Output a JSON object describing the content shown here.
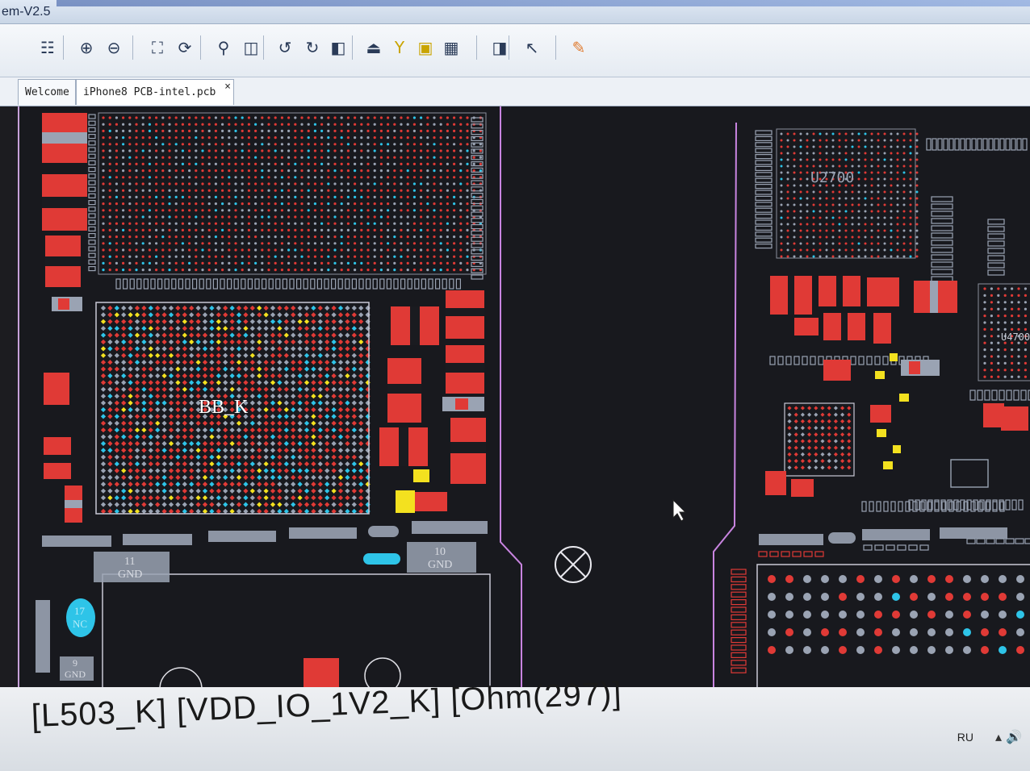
{
  "window": {
    "title": "em-V2.5"
  },
  "toolbar": {
    "icons": [
      {
        "name": "layers-tree-icon",
        "glyph": "☷"
      },
      {
        "name": "zoom-in-icon",
        "glyph": "⊕"
      },
      {
        "name": "zoom-out-icon",
        "glyph": "⊖"
      },
      {
        "name": "fit-view-icon",
        "glyph": "⛶"
      },
      {
        "name": "refresh-icon",
        "glyph": "⟳"
      },
      {
        "name": "search-icon",
        "glyph": "⚲"
      },
      {
        "name": "compare-icon",
        "glyph": "◫"
      },
      {
        "name": "rotate-left-icon",
        "glyph": "↺"
      },
      {
        "name": "rotate-right-icon",
        "glyph": "↻"
      },
      {
        "name": "mirror-icon",
        "glyph": "◧"
      },
      {
        "name": "probe-icon",
        "glyph": "⏏"
      },
      {
        "name": "pin-icon",
        "glyph": "Y"
      },
      {
        "name": "component-icon",
        "glyph": "▣"
      },
      {
        "name": "value-icon",
        "glyph": "▦"
      },
      {
        "name": "panel-icon",
        "glyph": "◨"
      },
      {
        "name": "pointer-icon",
        "glyph": "↖"
      },
      {
        "name": "notes-icon",
        "glyph": "✎"
      }
    ]
  },
  "tabs": [
    {
      "label": "Welcome"
    },
    {
      "label": "iPhone8 PCB-intel.pcb"
    }
  ],
  "pcb": {
    "labels": {
      "chip_left": "BB_K",
      "chip_top_right": "U2700",
      "chip_right": "U4700",
      "pad_11": "11",
      "pad_11_net": "GND",
      "pad_10": "10",
      "pad_10_net": "GND",
      "pad_17": "17",
      "pad_17_net": "NC",
      "pad_9": "9",
      "pad_9_net": "GND"
    },
    "colors": {
      "background": "#18191e",
      "pad_red": "#e03a36",
      "pad_grey": "#9aa3b3",
      "pad_cyan": "#2ec4e8",
      "pad_yellow": "#f3e11f",
      "outline_purple": "#c884e0"
    }
  },
  "status": {
    "text": "[L503_K] [VDD_IO_1V2_K] [Ohm(297)]"
  },
  "taskbar": {
    "language": "RU"
  }
}
